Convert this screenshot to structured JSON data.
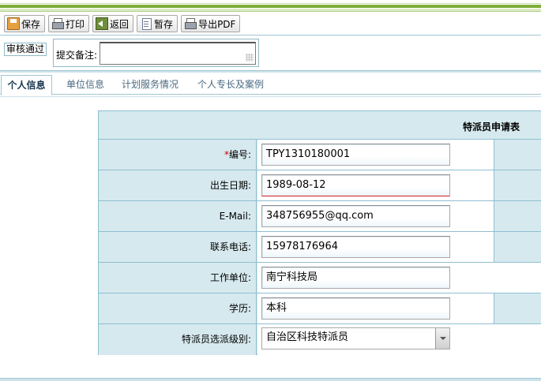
{
  "toolbar": {
    "save_label": "保存",
    "print_label": "打印",
    "back_label": "返回",
    "draft_label": "暂存",
    "export_label": "导出PDF"
  },
  "audit": {
    "status": "审核通过",
    "remark_label": "提交备注:",
    "remark_value": ""
  },
  "tabs": [
    {
      "label": "个人信息",
      "active": true
    },
    {
      "label": "单位信息"
    },
    {
      "label": "计划服务情况"
    },
    {
      "label": "个人专长及案例"
    }
  ],
  "form": {
    "title": "特派员申请表",
    "fields": [
      {
        "label": "编号:",
        "required_mark": "*",
        "value": "TPY1310180001"
      },
      {
        "label": "出生日期:",
        "value": "1989-08-12"
      },
      {
        "label": "E-Mail:",
        "value": "348756955@qq.com"
      },
      {
        "label": "联系电话:",
        "value": "15978176964"
      },
      {
        "label": "工作单位:",
        "value": "南宁科技局"
      },
      {
        "label": "学历:",
        "value": "本科"
      },
      {
        "label": "特派员选派级别:",
        "value": "自治区科技特派员"
      }
    ]
  },
  "colors": {
    "accent_green": "#7fae3a",
    "border_blue": "#8fbfd0",
    "label_bg": "#d6e9ef",
    "required_red": "#d40000"
  }
}
